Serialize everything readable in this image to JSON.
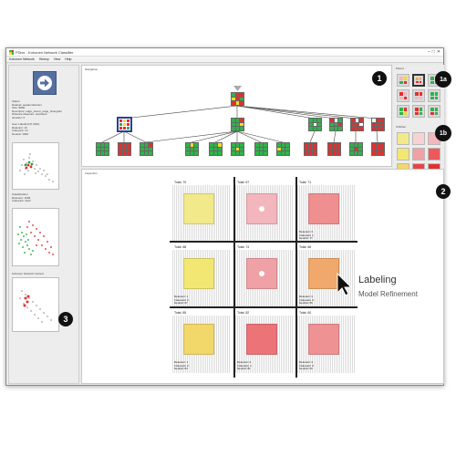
{
  "window": {
    "title": "FDive - Kohonen Network Classifier",
    "menu": [
      "Kohonen Network",
      "History",
      "View",
      "Help"
    ]
  },
  "left": {
    "status_lines": [
      "Status:",
      "Dataset: avatarcollection",
      "Size: 9800",
      "Descriptor: edge_stem2_edge_histogram",
      "Distance Measure: euclidean",
      "Iteration: 0"
    ],
    "user_labeled_title": "User Labelled (5 UNN)",
    "user_labeled_lines": [
      "Relevant: 10",
      "Irrelevant: 14",
      "Neutral: 1000"
    ],
    "classification_title": "Classification",
    "classification_lines": [
      "Relevant: 1048",
      "Irrelevant: 1122"
    ],
    "network_context_title": "Kohonen Network Context"
  },
  "panels": {
    "navigation": "Navigation",
    "inspection": "Inspection",
    "parent": "Parent",
    "children": "Children"
  },
  "badges": [
    "1",
    "1a",
    "1b",
    "2",
    "3"
  ],
  "annotation": {
    "title": "Labeling",
    "subtitle": "Model Refinement"
  },
  "tiles": [
    {
      "title": "Total: 70",
      "color": "#f2ea8a",
      "dot": false,
      "stats": []
    },
    {
      "title": "Total: 67",
      "color": "#f3b6bc",
      "dot": true,
      "stats": []
    },
    {
      "title": "Total: 71",
      "color": "#ef8f90",
      "dot": false,
      "stats": [
        "Relevant: 0",
        "Irrelevant: 1",
        "Neutral: 77"
      ]
    },
    {
      "title": "Total: 68",
      "color": "#f1e772",
      "dot": false,
      "stats": [
        "Relevant: 1",
        "Irrelevant: 0",
        "Neutral: 67"
      ]
    },
    {
      "title": "Total: 74",
      "color": "#f0a1a6",
      "dot": true,
      "stats": []
    },
    {
      "title": "Total: 66",
      "color": "#f0a86c",
      "dot": false,
      "stats": [
        "Relevant: 0",
        "Irrelevant: 0",
        "Neutral: 66"
      ]
    },
    {
      "title": "Total: 85",
      "color": "#f2d76a",
      "dot": false,
      "stats": [
        "Relevant: 1",
        "Irrelevant: 0",
        "Neutral: 84"
      ]
    },
    {
      "title": "Total: 82",
      "color": "#ec7378",
      "dot": false,
      "stats": [
        "Relevant: 0",
        "Irrelevant: 1",
        "Neutral: 81"
      ]
    },
    {
      "title": "Total: 60",
      "color": "#ef9294",
      "dot": false,
      "stats": [
        "Relevant: 0",
        "Irrelevant: 0",
        "Neutral: 60"
      ]
    }
  ],
  "colors": {
    "relevant": "#2fb34a",
    "irrelevant": "#e0312f",
    "uncertain": "#f2d92c",
    "accent": "#5470a0"
  }
}
